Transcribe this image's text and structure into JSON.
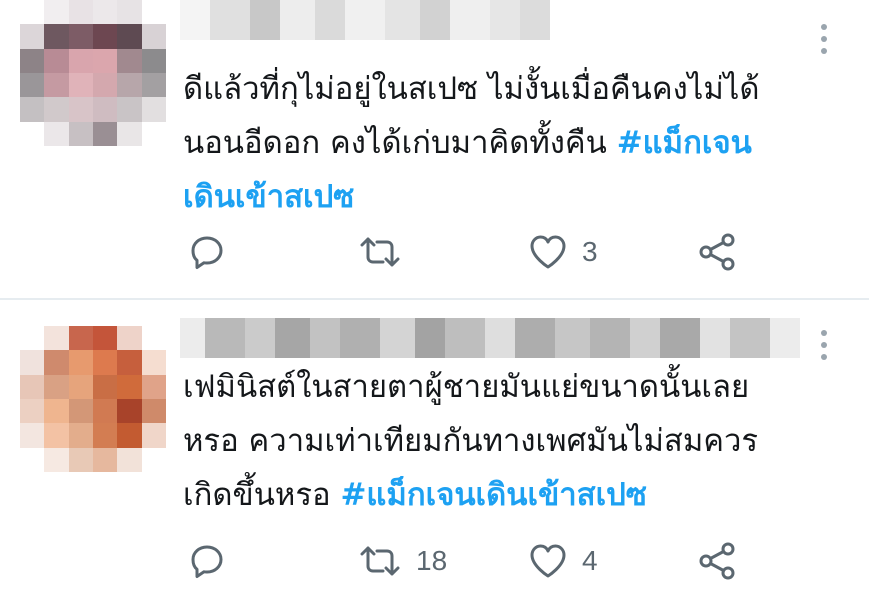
{
  "colors": {
    "hashtag": "#1da1f2",
    "text": "#14171a",
    "icon": "#5b6770",
    "divider": "#e6ecf0"
  },
  "tweets": [
    {
      "text": "ดีแล้วที่กุไม่อยู่ในสเปซ ไม่งั้นเมื่อคืนคงไม่ได้\nนอนอีดอก คงได้เก่บมาคิดทั้งคืน ",
      "hashtag": "#แม็กเจน\nเดินเข้าสเปซ",
      "reply_icon": "reply-icon",
      "retweet_icon": "retweet-icon",
      "retweet_count": "",
      "like_icon": "heart-icon",
      "like_count": "3",
      "share_icon": "share-icon",
      "more_icon": "more-vertical-icon"
    },
    {
      "text": "เฟมินิสต์ในสายตาผู้ชายมันแย่ขนาดนั้นเลย\nหรอ ความเท่าเทียมกันทางเพศมันไม่สมควร\nเกิดขึ้นหรอ ",
      "hashtag": "#แม็กเจนเดินเข้าสเปซ",
      "reply_icon": "reply-icon",
      "retweet_icon": "retweet-icon",
      "retweet_count": "18",
      "like_icon": "heart-icon",
      "like_count": "4",
      "share_icon": "share-icon",
      "more_icon": "more-vertical-icon"
    }
  ]
}
